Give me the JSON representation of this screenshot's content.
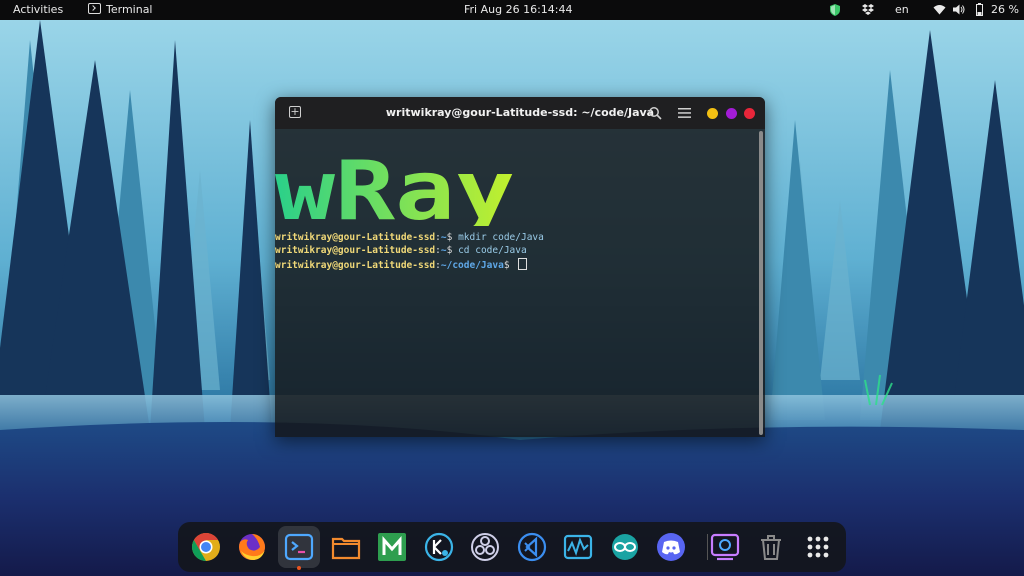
{
  "topbar": {
    "activities": "Activities",
    "app_name": "Terminal",
    "clock": "Fri Aug 26  16:14:44",
    "keyboard_layout": "en",
    "battery_percent": "26 %"
  },
  "terminal": {
    "title": "writwikray@gour-Latitude-ssd: ~/code/Java",
    "banner_text": "wRay",
    "lines": [
      {
        "user_host": "writwikray@gour-Latitude-ssd",
        "sep": ":",
        "path": "~",
        "prompt": "$ ",
        "command": "mkdir code/Java"
      },
      {
        "user_host": "writwikray@gour-Latitude-ssd",
        "sep": ":",
        "path": "~",
        "prompt": "$ ",
        "command": "cd code/Java"
      },
      {
        "user_host": "writwikray@gour-Latitude-ssd",
        "sep": ":",
        "path": "~/code/Java",
        "prompt": "$ ",
        "command": ""
      }
    ]
  },
  "dock": {
    "apps": [
      "google-chrome-icon",
      "firefox-icon",
      "terminal-icon",
      "files-icon",
      "mendeley-icon",
      "kdeconnect-icon",
      "obs-studio-icon",
      "vscode-icon",
      "system-monitor-icon",
      "arduino-icon",
      "discord-icon",
      "screen-recorder-icon",
      "trash-icon",
      "show-apps-icon"
    ]
  },
  "colors": {
    "accent": "#e95420",
    "prompt_user": "#f0d878",
    "prompt_path": "#5fa8e8",
    "banner_gradient_start": "#2ad08a",
    "banner_gradient_end": "#c4f02c"
  }
}
